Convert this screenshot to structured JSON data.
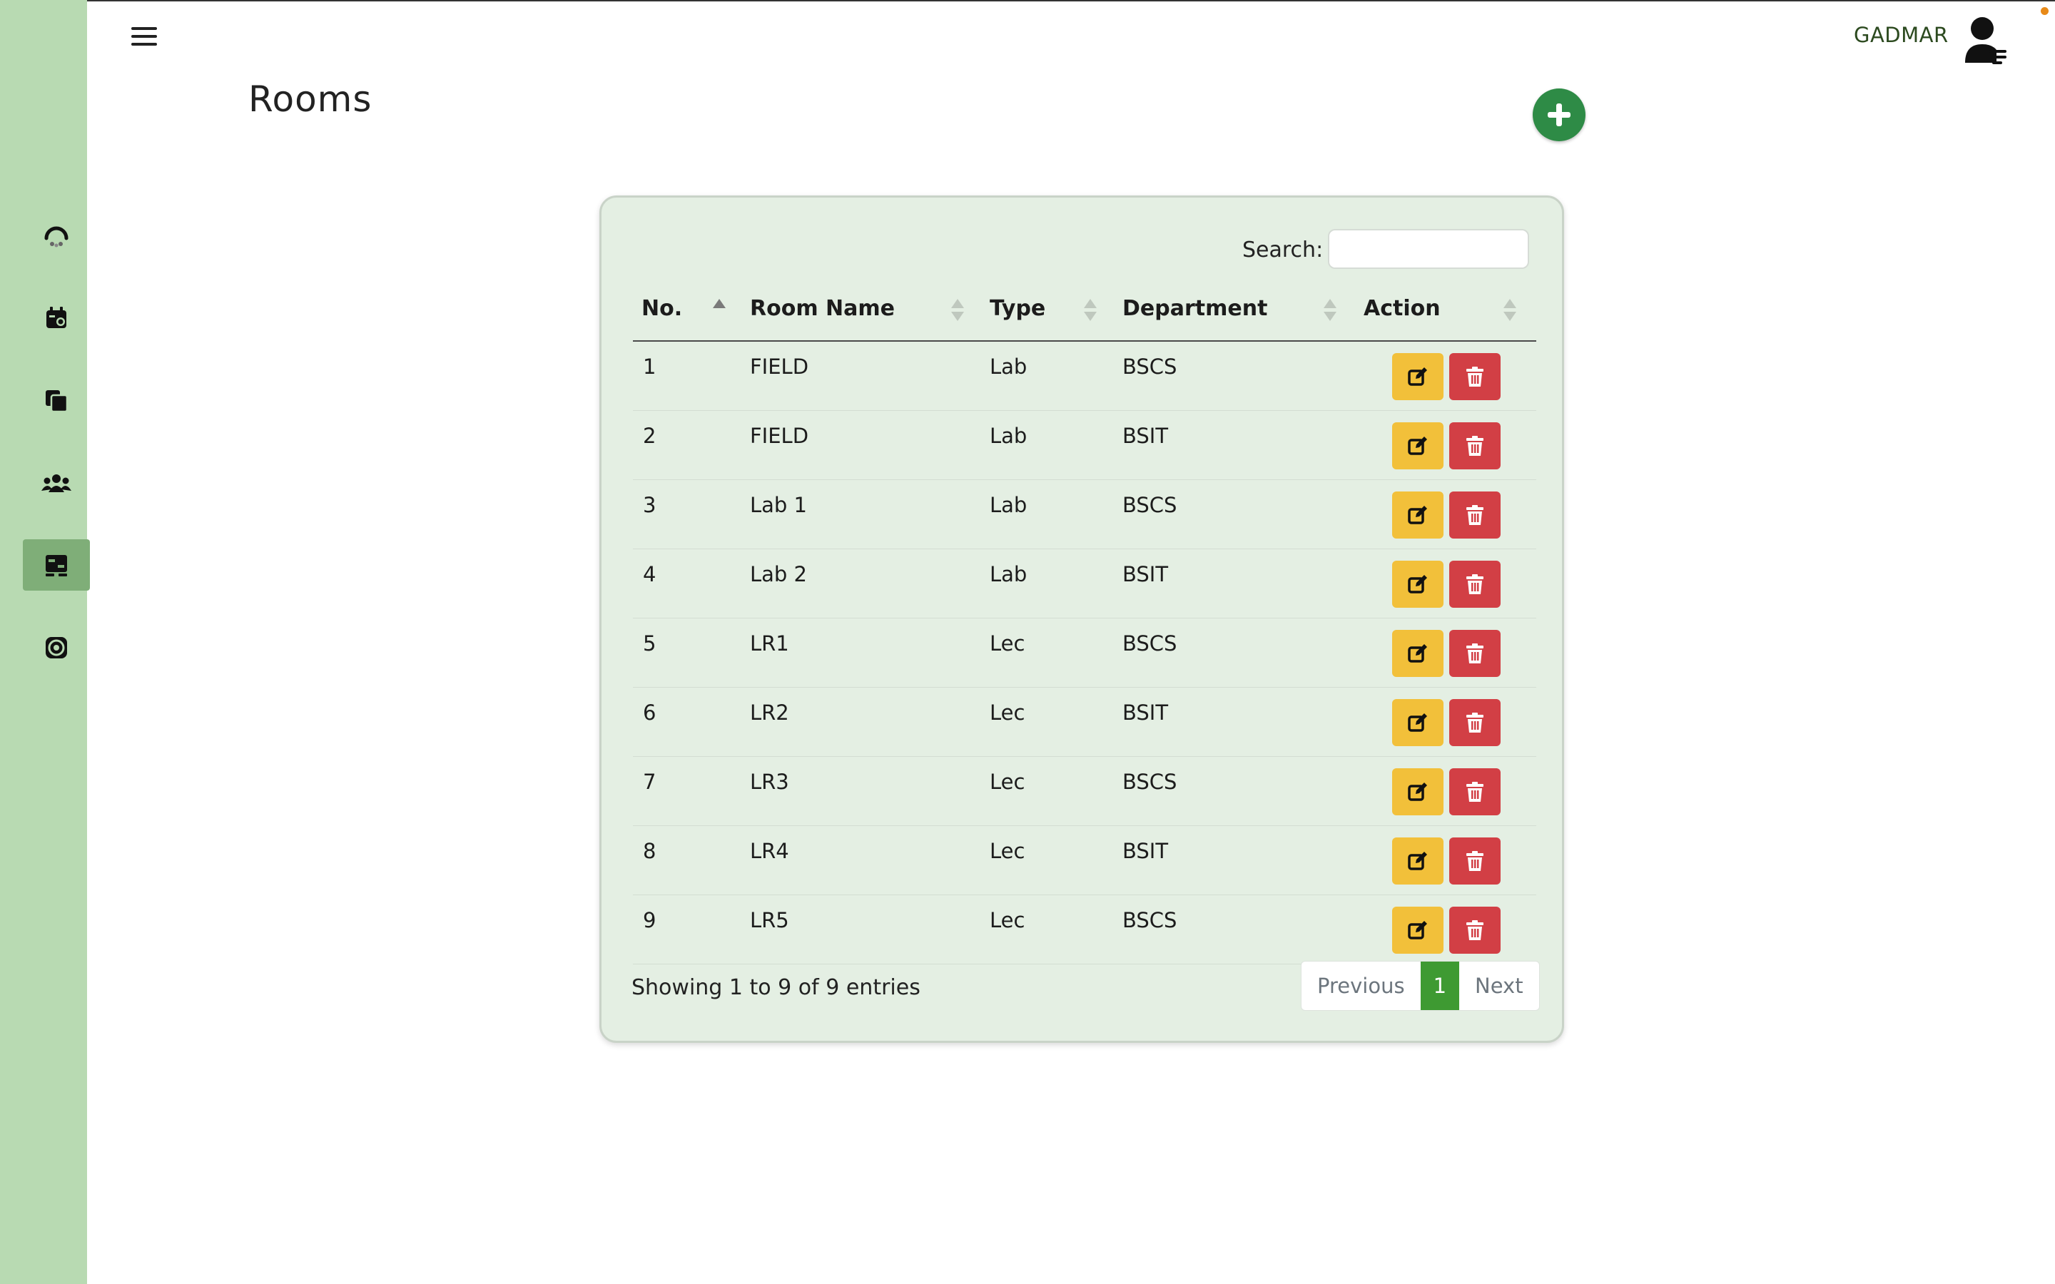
{
  "header": {
    "user_name": "GADMAR"
  },
  "page": {
    "title": "Rooms"
  },
  "sidebar": {
    "items": [
      {
        "icon": "dashboard-gauge-icon",
        "active": false
      },
      {
        "icon": "calendar-icon",
        "active": false
      },
      {
        "icon": "documents-icon",
        "active": false
      },
      {
        "icon": "users-icon",
        "active": false
      },
      {
        "icon": "rooms-icon",
        "active": true
      },
      {
        "icon": "settings-icon",
        "active": false
      }
    ]
  },
  "search": {
    "label": "Search:",
    "value": "",
    "placeholder": ""
  },
  "table": {
    "columns": [
      "No.",
      "Room Name",
      "Type",
      "Department",
      "Action"
    ],
    "sorted_column": "No.",
    "sort_direction": "ascending",
    "rows": [
      {
        "no": "1",
        "name": "FIELD",
        "type": "Lab",
        "dept": "BSCS"
      },
      {
        "no": "2",
        "name": "FIELD",
        "type": "Lab",
        "dept": "BSIT"
      },
      {
        "no": "3",
        "name": "Lab 1",
        "type": "Lab",
        "dept": "BSCS"
      },
      {
        "no": "4",
        "name": "Lab 2",
        "type": "Lab",
        "dept": "BSIT"
      },
      {
        "no": "5",
        "name": "LR1",
        "type": "Lec",
        "dept": "BSCS"
      },
      {
        "no": "6",
        "name": "LR2",
        "type": "Lec",
        "dept": "BSIT"
      },
      {
        "no": "7",
        "name": "LR3",
        "type": "Lec",
        "dept": "BSCS"
      },
      {
        "no": "8",
        "name": "LR4",
        "type": "Lec",
        "dept": "BSIT"
      },
      {
        "no": "9",
        "name": "LR5",
        "type": "Lec",
        "dept": "BSCS"
      }
    ]
  },
  "footer": {
    "info": "Showing 1 to 9 of 9 entries",
    "previous": "Previous",
    "current_page": "1",
    "next": "Next"
  },
  "colors": {
    "sidebar": "#b8dab2",
    "sidebar_active": "#7fae78",
    "add_button": "#2e8b46",
    "edit_button": "#f2c03a",
    "delete_button": "#d23f45",
    "pager_active": "#3e9a32",
    "card_bg": "#e4efe3"
  }
}
